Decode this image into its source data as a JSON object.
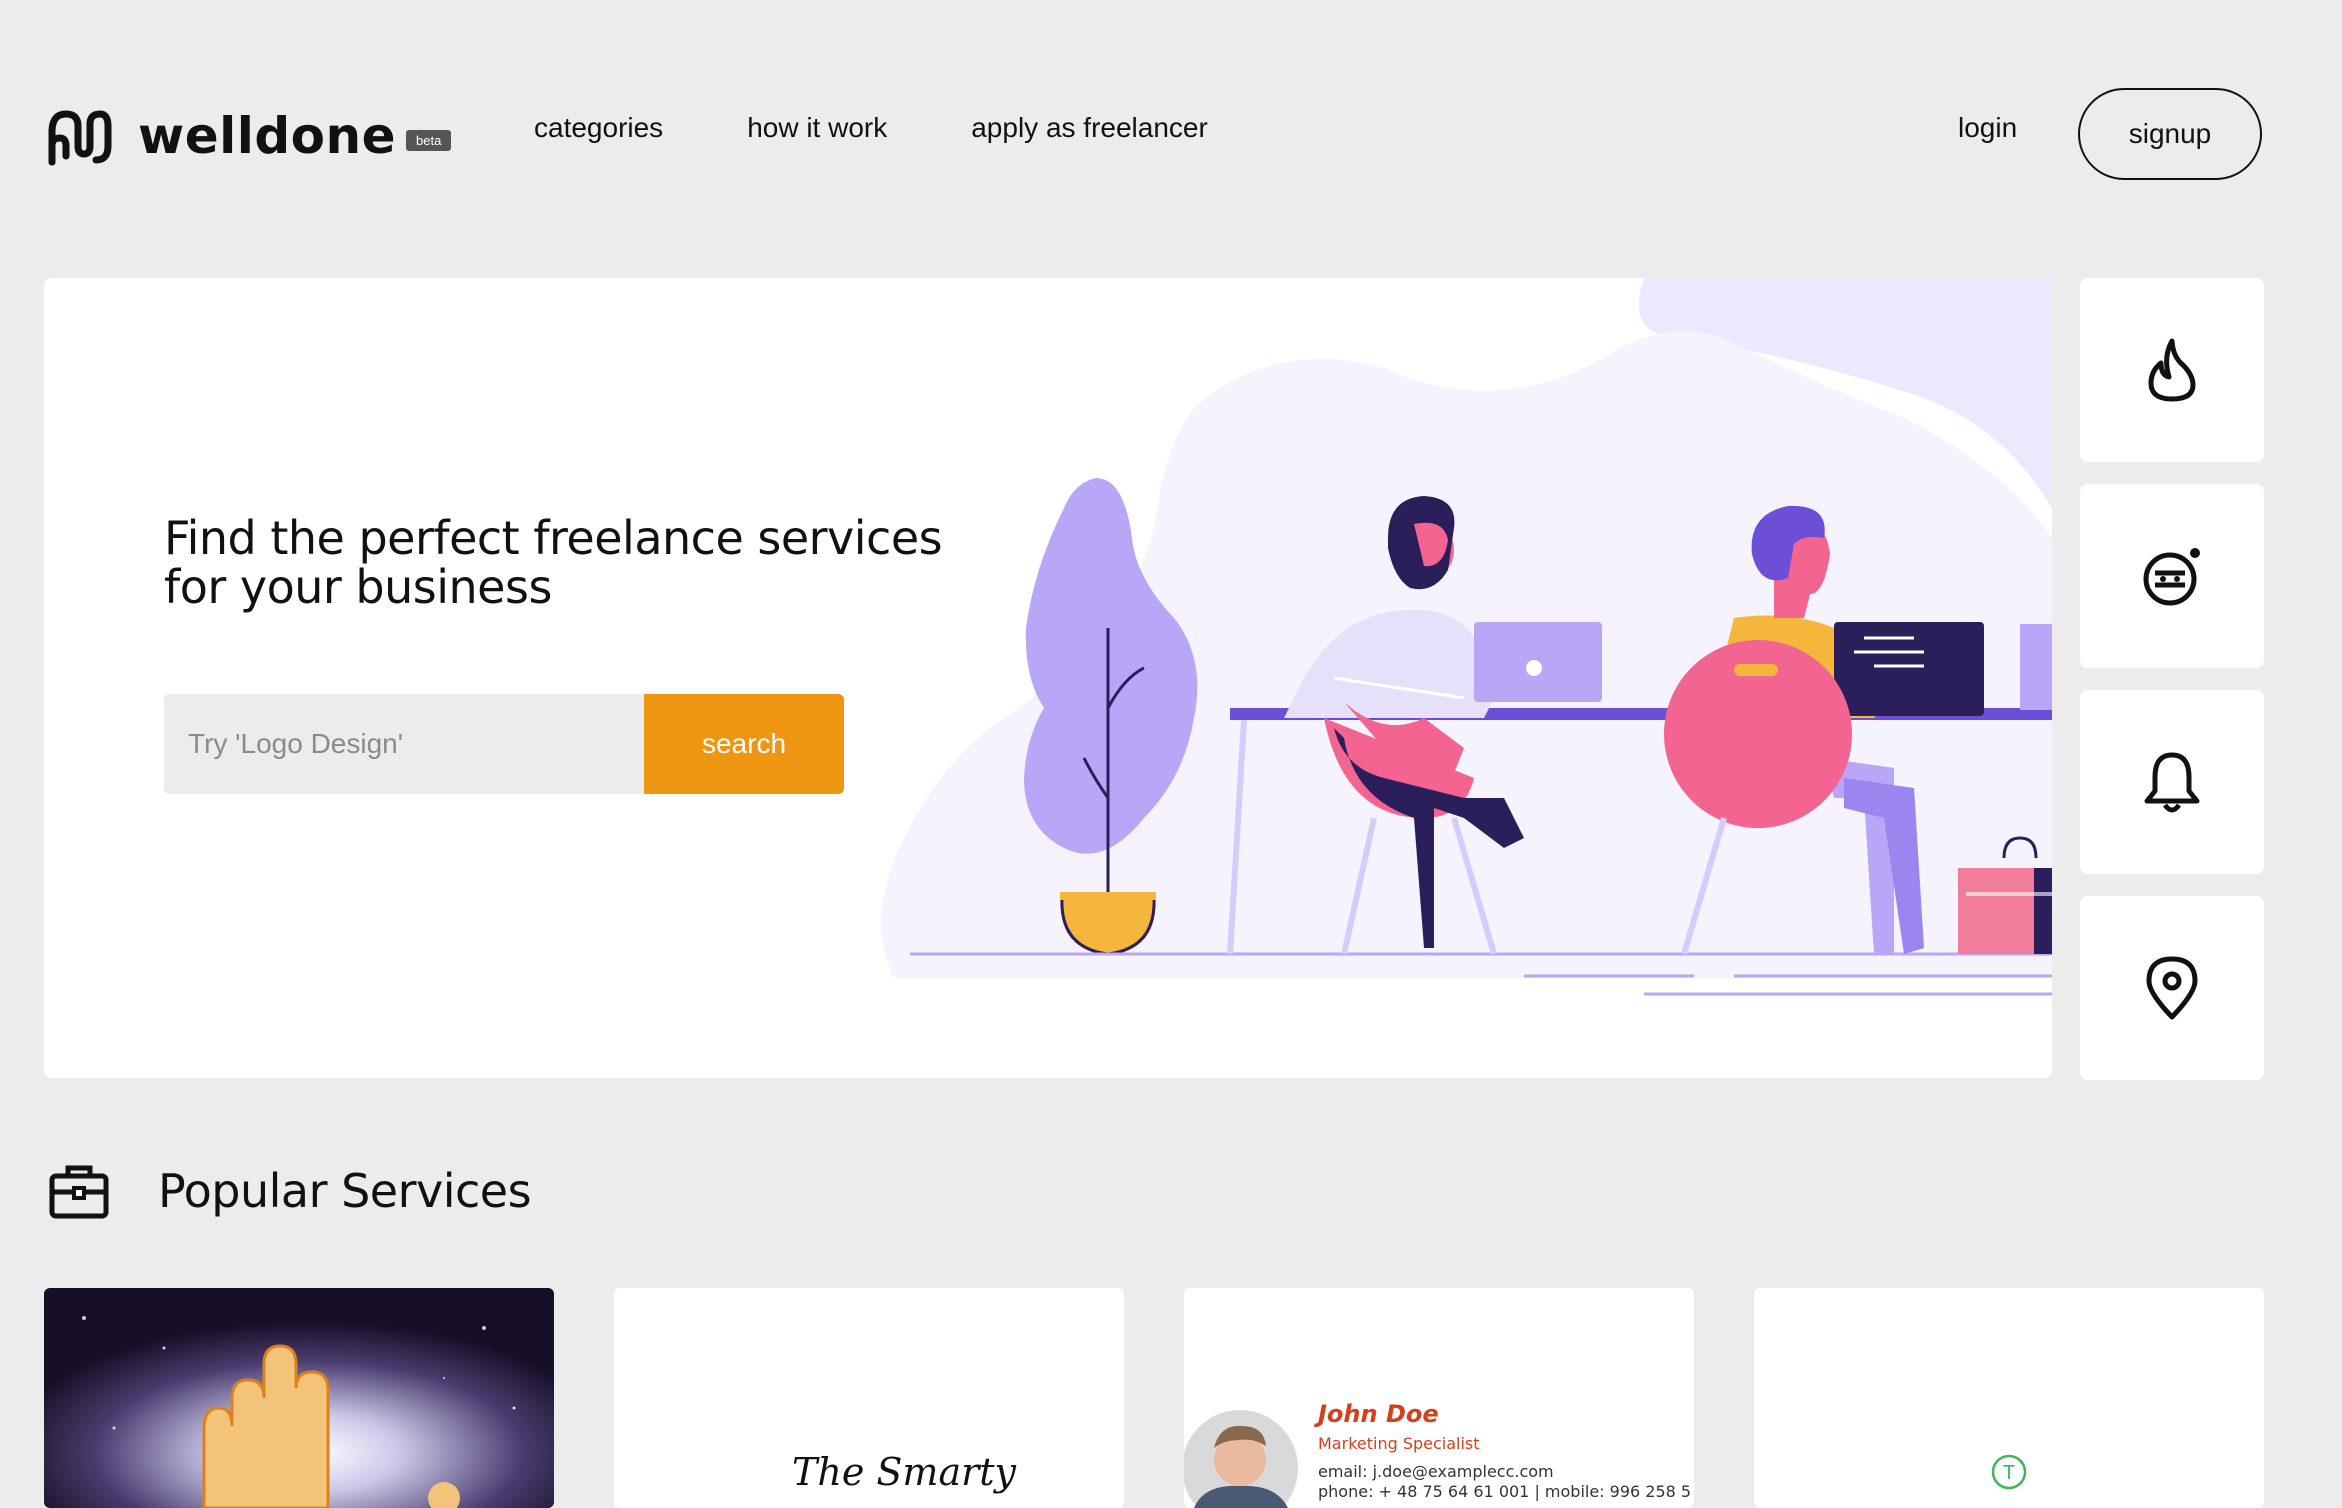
{
  "header": {
    "brand": "welldone",
    "badge": "beta",
    "nav": [
      "categories",
      "how it work",
      "apply as freelancer"
    ],
    "login": "login",
    "signup": "signup"
  },
  "hero": {
    "title": "Find the perfect freelance services for your business",
    "search_placeholder": "Try 'Logo Design'",
    "search_button": "search"
  },
  "side_icons": [
    "flame-icon",
    "emoji-chat-icon",
    "bell-icon",
    "map-pin-icon"
  ],
  "popular": {
    "title": "Popular Services",
    "cards": [
      {
        "id": "palmistry"
      },
      {
        "id": "logo",
        "text": "The Smarty"
      },
      {
        "id": "business-card",
        "name": "John Doe",
        "role": "Marketing Specialist",
        "email": "email: j.doe@examplecc.com",
        "phone": "phone: + 48 75 64 61 001 | mobile: 996 258 5"
      },
      {
        "id": "teal-logo",
        "text": "T"
      }
    ]
  },
  "colors": {
    "accent": "#ee9611",
    "purple": "#6c4fd6",
    "pink": "#f46490",
    "lavender": "#b9a6f7"
  }
}
